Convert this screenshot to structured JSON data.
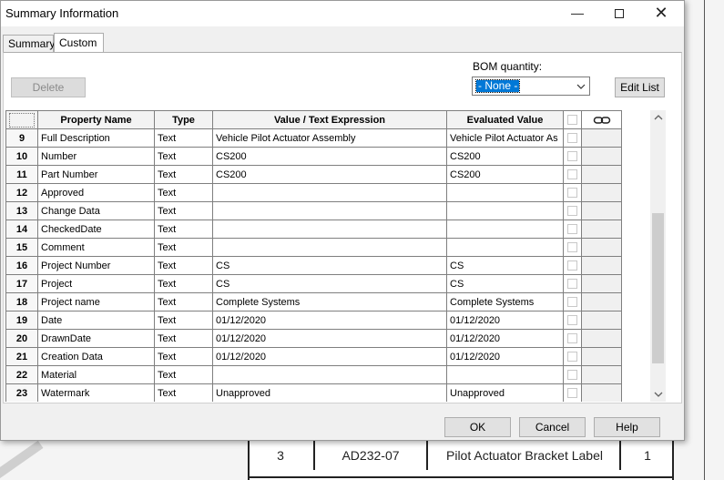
{
  "window": {
    "title": "Summary Information",
    "minimize_glyph": "—",
    "close_glyph": "✕"
  },
  "tabs": [
    {
      "label": "Summary",
      "active": false
    },
    {
      "label": "Custom",
      "active": true
    }
  ],
  "toolbar": {
    "delete_label": "Delete",
    "bom_label": "BOM quantity:",
    "bom_value": "- None -",
    "edit_list_label": "Edit List"
  },
  "table": {
    "columns": [
      "Property Name",
      "Type",
      "Value / Text Expression",
      "Evaluated Value"
    ],
    "rows": [
      {
        "num": "9",
        "name": "Full Description",
        "type": "Text",
        "value": "Vehicle Pilot Actuator Assembly",
        "evaluated": "Vehicle Pilot Actuator As"
      },
      {
        "num": "10",
        "name": "Number",
        "type": "Text",
        "value": "CS200",
        "evaluated": "CS200"
      },
      {
        "num": "11",
        "name": "Part Number",
        "type": "Text",
        "value": "CS200",
        "evaluated": "CS200"
      },
      {
        "num": "12",
        "name": "Approved",
        "type": "Text",
        "value": "",
        "evaluated": ""
      },
      {
        "num": "13",
        "name": "Change Data",
        "type": "Text",
        "value": "",
        "evaluated": ""
      },
      {
        "num": "14",
        "name": "CheckedDate",
        "type": "Text",
        "value": "",
        "evaluated": ""
      },
      {
        "num": "15",
        "name": "Comment",
        "type": "Text",
        "value": "",
        "evaluated": ""
      },
      {
        "num": "16",
        "name": "Project Number",
        "type": "Text",
        "value": "CS",
        "evaluated": "CS"
      },
      {
        "num": "17",
        "name": "Project",
        "type": "Text",
        "value": "CS",
        "evaluated": "CS"
      },
      {
        "num": "18",
        "name": "Project name",
        "type": "Text",
        "value": "Complete Systems",
        "evaluated": "Complete Systems"
      },
      {
        "num": "19",
        "name": "Date",
        "type": "Text",
        "value": "01/12/2020",
        "evaluated": "01/12/2020"
      },
      {
        "num": "20",
        "name": "DrawnDate",
        "type": "Text",
        "value": "01/12/2020",
        "evaluated": "01/12/2020"
      },
      {
        "num": "21",
        "name": "Creation Data",
        "type": "Text",
        "value": "01/12/2020",
        "evaluated": "01/12/2020"
      },
      {
        "num": "22",
        "name": "Material",
        "type": "Text",
        "value": "",
        "evaluated": ""
      },
      {
        "num": "23",
        "name": "Watermark",
        "type": "Text",
        "value": "Unapproved",
        "evaluated": "Unapproved"
      }
    ]
  },
  "footer": {
    "ok_label": "OK",
    "cancel_label": "Cancel",
    "help_label": "Help"
  },
  "background_table": {
    "cells": [
      "3",
      "AD232-07",
      "Pilot Actuator Bracket Label",
      "1"
    ]
  }
}
